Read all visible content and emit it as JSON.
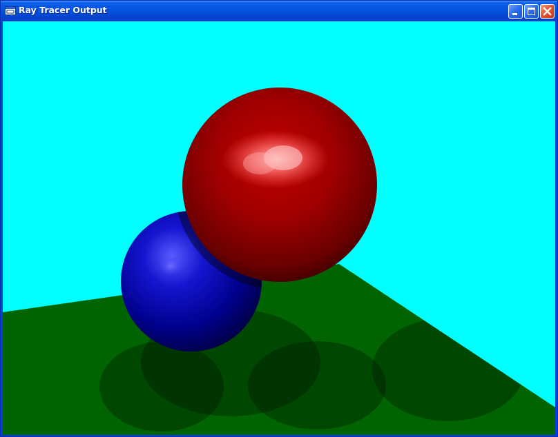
{
  "window": {
    "title": "Ray Tracer Output",
    "controls": [
      "minimize",
      "maximize",
      "close"
    ]
  },
  "icons": {
    "app": "window-app-icon",
    "minimize": "minimize-icon",
    "maximize": "maximize-icon",
    "close": "close-icon"
  },
  "scene": {
    "background_color": "#00FFFF",
    "floor_color": "#006400",
    "spheres": [
      {
        "name": "red-sphere",
        "color": "#B00000"
      },
      {
        "name": "blue-sphere",
        "color": "#0000B0"
      }
    ]
  }
}
